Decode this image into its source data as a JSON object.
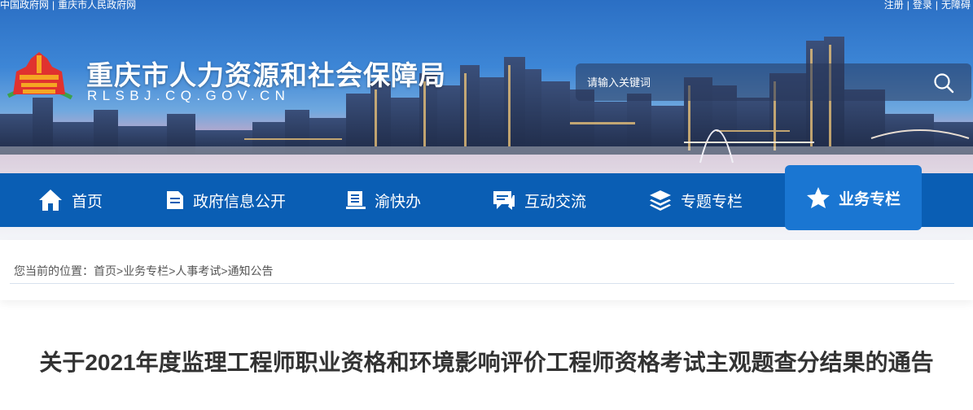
{
  "top_links": {
    "gov_portal": "中国政府网",
    "city_portal": "重庆市人民政府网",
    "register": "注册",
    "login": "登录",
    "accessibility": "无障碍"
  },
  "site": {
    "title": "重庆市人力资源和社会保障局",
    "domain": "RLSBJ.CQ.GOV.CN"
  },
  "search": {
    "placeholder": "请输入关键词"
  },
  "nav": {
    "items": [
      {
        "label": "首页",
        "icon": "home-icon"
      },
      {
        "label": "政府信息公开",
        "icon": "document-icon"
      },
      {
        "label": "渝快办",
        "icon": "book-icon"
      },
      {
        "label": "互动交流",
        "icon": "chat-icon"
      },
      {
        "label": "专题专栏",
        "icon": "layers-icon"
      },
      {
        "label": "业务专栏",
        "icon": "star-icon"
      }
    ]
  },
  "breadcrumb": {
    "prefix": "您当前的位置：",
    "items": [
      "首页",
      "业务专栏",
      "人事考试",
      "通知公告"
    ],
    "separator": ">"
  },
  "article": {
    "title": "关于2021年度监理工程师职业资格和环境影响评价工程师资格考试主观题查分结果的通告"
  },
  "colors": {
    "nav_bg": "#0a5eb4",
    "nav_active_bg": "#1a76d2",
    "text": "#333333"
  }
}
